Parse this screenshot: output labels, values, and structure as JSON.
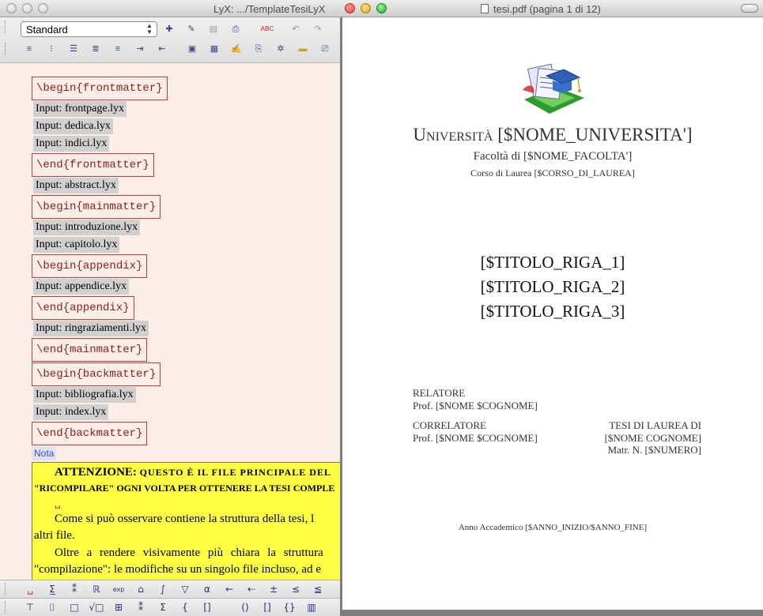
{
  "lyx": {
    "title": "LyX: .../TemplateTesiLyX",
    "paragraph_style": "Standard",
    "document_lines": [
      {
        "kind": "ert",
        "text": "\\begin{frontmatter}"
      },
      {
        "kind": "input",
        "text": "Input: frontpage.lyx"
      },
      {
        "kind": "input",
        "text": "Input: dedica.lyx"
      },
      {
        "kind": "input",
        "text": "Input: indici.lyx"
      },
      {
        "kind": "ert",
        "text": "\\end{frontmatter}"
      },
      {
        "kind": "input",
        "text": "Input: abstract.lyx"
      },
      {
        "kind": "ert",
        "text": "\\begin{mainmatter}"
      },
      {
        "kind": "input",
        "text": "Input: introduzione.lyx"
      },
      {
        "kind": "input",
        "text": "Input: capitolo.lyx"
      },
      {
        "kind": "ert",
        "text": "\\begin{appendix}"
      },
      {
        "kind": "input",
        "text": "Input: appendice.lyx"
      },
      {
        "kind": "ert",
        "text": "\\end{appendix}"
      },
      {
        "kind": "input",
        "text": "Input: ringraziamenti.lyx"
      },
      {
        "kind": "ert",
        "text": "\\end{mainmatter}"
      },
      {
        "kind": "ert",
        "text": "\\begin{backmatter}"
      },
      {
        "kind": "input",
        "text": "Input: bibliografia.lyx"
      },
      {
        "kind": "input",
        "text": "Input: index.lyx"
      },
      {
        "kind": "ert",
        "text": "\\end{backmatter}"
      }
    ],
    "note": {
      "label": "Nota",
      "line1_bold": "ATTENZIONE:",
      "line1_rest": "QUESTO È IL FILE PRINCIPALE DEL",
      "line2": "\"RICOMPILARE\" OGNI VOLTA PER OTTENERE LA TESI COMPLE",
      "line3": "␣",
      "line4": "Come si può osservare contiene la struttura della tesi, l",
      "line5": "altri file.",
      "line6": "Oltre a rendere visivamente più chiara la struttura",
      "line7": "\"compilazione\": le modifiche su un singolo file incluso, ad e"
    },
    "math_toolbar_1": [
      "␣",
      "Σ̲",
      "⁑",
      "ℝ",
      "exp",
      "⌂",
      "∫",
      "▽",
      "α",
      "←",
      "⇠",
      "±",
      "≤",
      "≦"
    ],
    "math_toolbar_2": [
      "⊤",
      "⌷",
      "□",
      "√□",
      "⊞",
      "⁑",
      "Σ",
      "{",
      "[]",
      "()",
      "[]",
      "{}",
      "▥"
    ]
  },
  "pdf": {
    "title": "tesi.pdf (pagina 1 di 12)",
    "university": "Università [$NOME_UNIVERSITA']",
    "faculty": "Facoltà di [$NOME_FACOLTA']",
    "course": "Corso di Laurea [$CORSO_DI_LAUREA]",
    "title_lines": [
      "[$TITOLO_RIGA_1]",
      "[$TITOLO_RIGA_2]",
      "[$TITOLO_RIGA_3]"
    ],
    "relatore_label": "RELATORE",
    "relatore_name": "Prof. [$NOME $COGNOME]",
    "correlatore_label": "CORRELATORE",
    "correlatore_name": "Prof. [$NOME $COGNOME]",
    "tesi_label": "TESI DI LAUREA DI",
    "tesi_name": "[$NOME COGNOME]",
    "matricola": "Matr. N. [$NUMERO]",
    "anno": "Anno Accademico [$ANNO_INIZIO/$ANNO_FINE]"
  },
  "colors": {
    "ert_border": "#c23a3a",
    "ert_text": "#8b1c1c",
    "note_bg": "#ffff44",
    "doc_bg": "#fbeee6",
    "traffic_red": "#e0443e",
    "traffic_yellow": "#dea123",
    "traffic_green": "#1aab29"
  }
}
